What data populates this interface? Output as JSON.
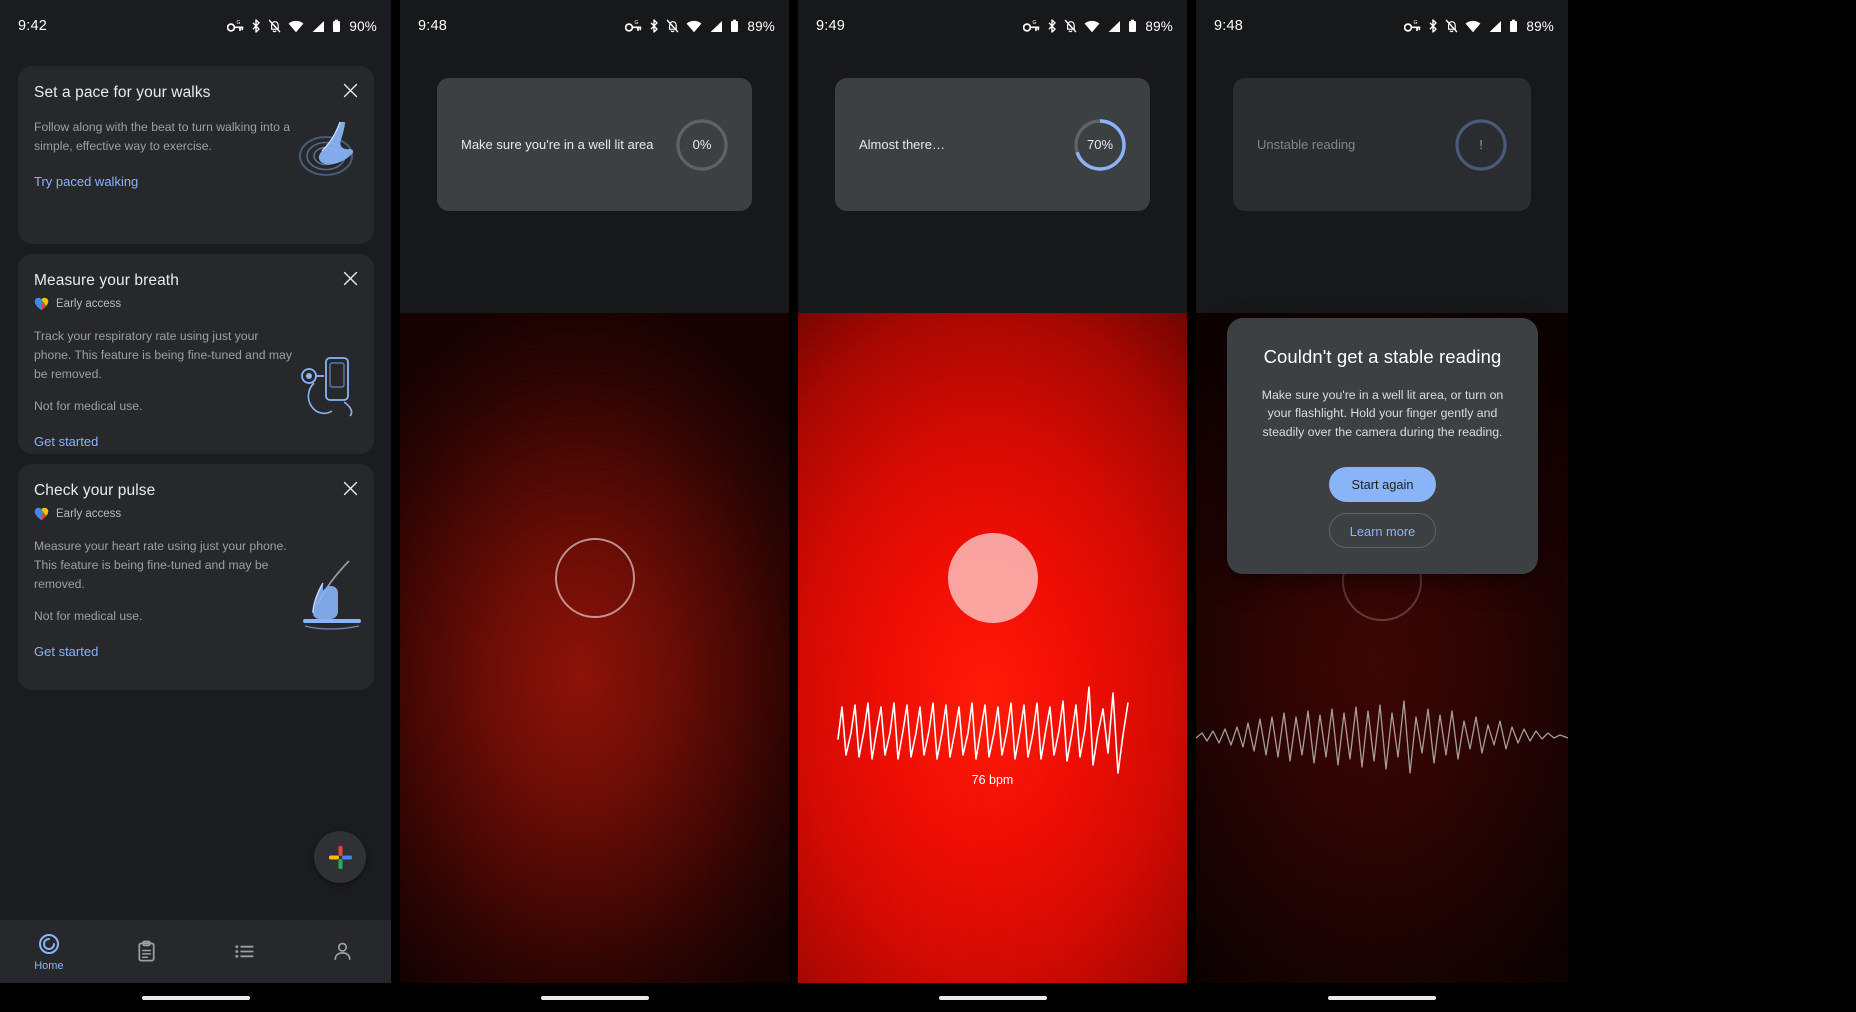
{
  "panels": [
    {
      "id": "home",
      "status": {
        "time": "9:42",
        "battery": "90%",
        "icons": [
          "vpn-key-icon",
          "bluetooth-icon",
          "notifications-off-icon",
          "wifi-icon",
          "signal-icon",
          "battery-icon"
        ]
      },
      "cards": [
        {
          "title": "Set a pace for your walks",
          "badge": null,
          "desc": "Follow along with the beat to turn walking into a simple, effective way to exercise.",
          "desc2": null,
          "link": "Try paced walking",
          "art": "walking-shoe-illustration",
          "close": "close-icon"
        },
        {
          "title": "Measure your breath",
          "badge": "Early access",
          "desc": "Track your respiratory rate using just your phone. This feature is being fine-tuned and may be removed.",
          "desc2": "Not for medical use.",
          "link": "Get started",
          "art": "phone-breath-illustration",
          "close": "close-icon"
        },
        {
          "title": "Check your pulse",
          "badge": "Early access",
          "desc": "Measure your heart rate using just your phone. This feature is being fine-tuned and may be removed.",
          "desc2": "Not for medical use.",
          "link": "Get started",
          "art": "finger-camera-illustration",
          "close": "close-icon"
        }
      ],
      "fab": {
        "name": "add-button",
        "icon": "google-plus-icon"
      },
      "nav": [
        {
          "label": "Home",
          "icon": "home-ring-icon",
          "active": true
        },
        {
          "label": "",
          "icon": "journal-clipboard-icon",
          "active": false
        },
        {
          "label": "",
          "icon": "browse-list-icon",
          "active": false
        },
        {
          "label": "",
          "icon": "profile-person-icon",
          "active": false
        }
      ]
    },
    {
      "id": "measure-start",
      "status": {
        "time": "9:48",
        "battery": "89%"
      },
      "card": {
        "message": "Make sure you're in a well lit area",
        "progress": 0,
        "progress_label": "0%",
        "state": "idle"
      },
      "camera": {
        "indicator": "ring-outline",
        "bpm": null
      }
    },
    {
      "id": "measure-progress",
      "status": {
        "time": "9:49",
        "battery": "89%"
      },
      "card": {
        "message": "Almost there…",
        "progress": 70,
        "progress_label": "70%",
        "state": "active"
      },
      "camera": {
        "indicator": "ring-filled",
        "bpm": "76 bpm"
      }
    },
    {
      "id": "measure-error",
      "status": {
        "time": "9:48",
        "battery": "89%"
      },
      "card": {
        "message": "Unstable reading",
        "progress": null,
        "progress_label": "!",
        "state": "error"
      },
      "camera": {
        "indicator": "ring-faint",
        "bpm": null
      },
      "dialog": {
        "title": "Couldn't get a stable reading",
        "body": "Make sure you're in a well lit area, or turn on your flashlight. Hold your finger gently and steadily over the camera during the reading.",
        "primary_button": "Start again",
        "secondary_button": "Learn more"
      }
    }
  ],
  "colors": {
    "accent_blue": "#8ab4f8",
    "card_bg": "#26282c",
    "dialog_bg": "#3c4043",
    "page_bg": "#1b1c1f"
  }
}
